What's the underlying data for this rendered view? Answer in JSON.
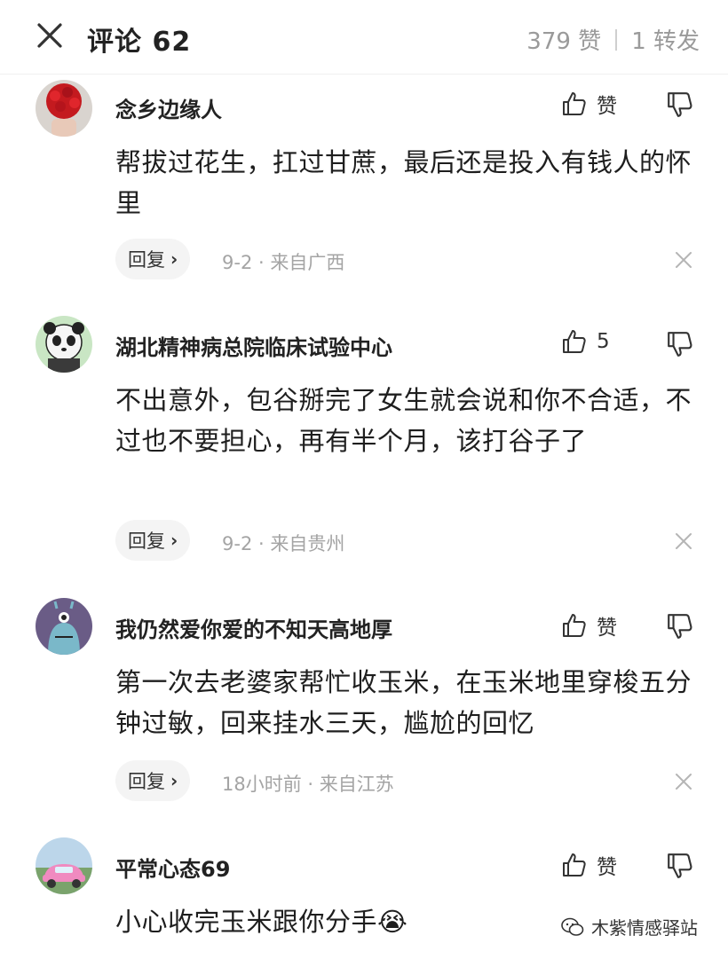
{
  "header": {
    "title": "评论 62",
    "likes": "379 赞",
    "shares": "1 转发"
  },
  "comments": [
    {
      "username": "念乡边缘人",
      "like_label": "赞",
      "text": "帮拔过花生，扛过甘蔗，最后还是投入有钱人的怀里",
      "reply_label": "回复",
      "meta": "9-2 · 来自广西",
      "avatar": "roses-avatar"
    },
    {
      "username": "湖北精神病总院临床试验中心",
      "like_label": "5",
      "text": "不出意外，包谷掰完了女生就会说和你不合适，不过也不要担心，再有半个月，该打谷子了",
      "reply_label": "回复",
      "meta": "9-2 · 来自贵州",
      "avatar": "panda-avatar"
    },
    {
      "username": "我仍然爱你爱的不知天高地厚",
      "like_label": "赞",
      "text": "第一次去老婆家帮忙收玉米，在玉米地里穿梭五分钟过敏，回来挂水三天，尴尬的回忆",
      "reply_label": "回复",
      "meta": "18小时前 · 来自江苏",
      "avatar": "monster-avatar"
    },
    {
      "username": "平常心态69",
      "like_label": "赞",
      "text": "小心收完玉米跟你分手😭",
      "avatar": "pink-car-avatar"
    }
  ],
  "watermark": "木紫情感驿站",
  "colors": {
    "text": "#1e1e1e",
    "meta": "#a4a4a4",
    "reply_bg": "#f4f4f4"
  }
}
